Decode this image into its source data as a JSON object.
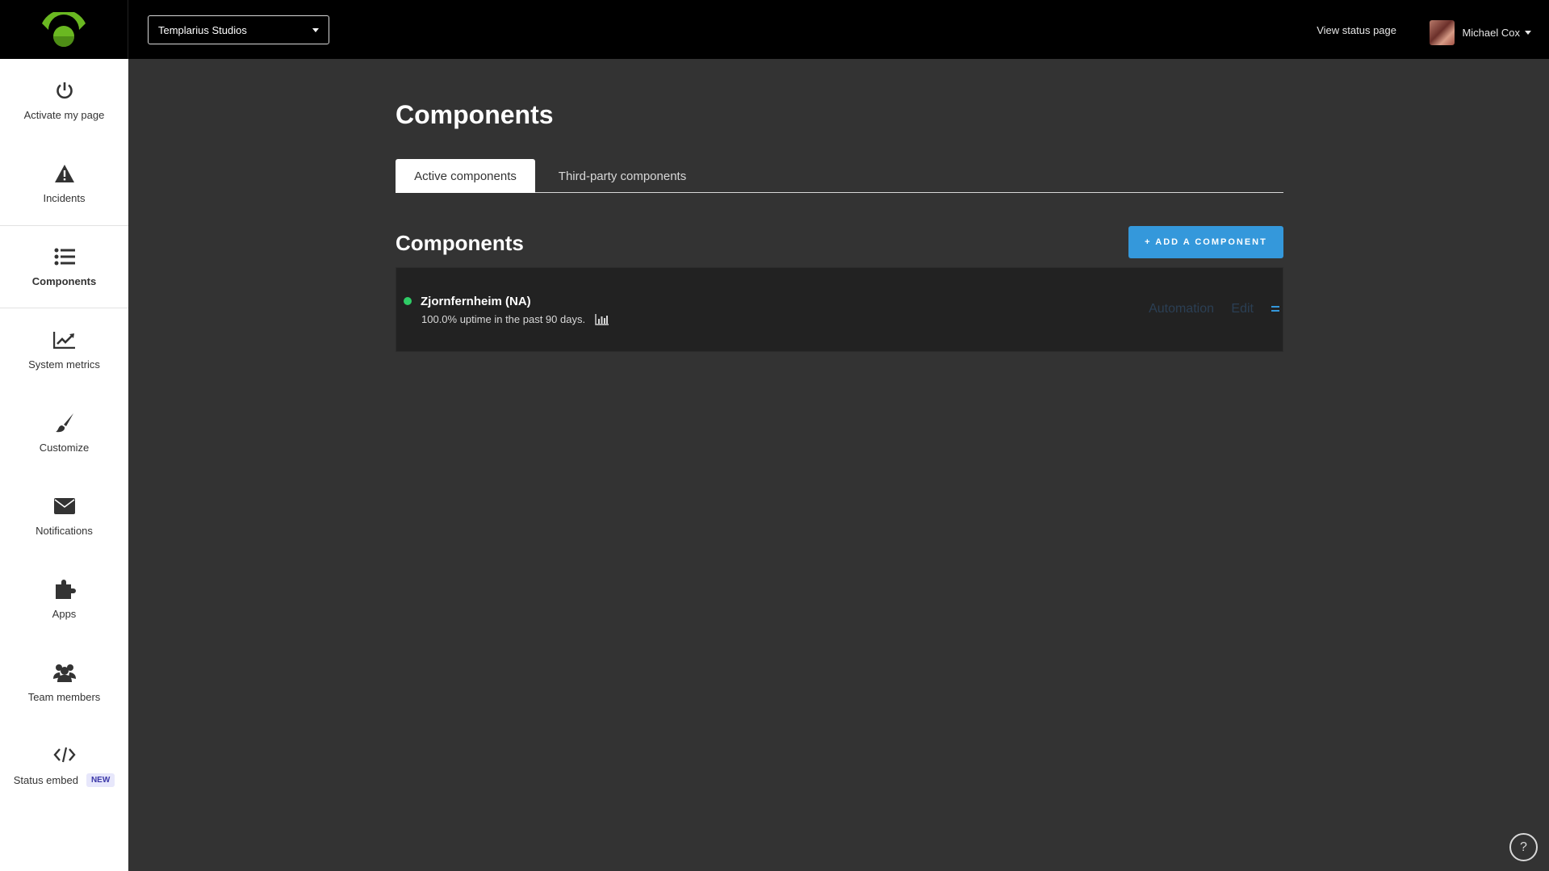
{
  "header": {
    "page_selector": "Templarius Studios",
    "view_status_link": "View status page",
    "user_name": "Michael Cox"
  },
  "sidebar": {
    "items": [
      {
        "label": "Activate my page",
        "icon": "power-icon"
      },
      {
        "label": "Incidents",
        "icon": "warning-icon"
      },
      {
        "label": "Components",
        "icon": "list-icon"
      },
      {
        "label": "System metrics",
        "icon": "line-chart-icon"
      },
      {
        "label": "Customize",
        "icon": "brush-icon"
      },
      {
        "label": "Notifications",
        "icon": "envelope-icon"
      },
      {
        "label": "Apps",
        "icon": "puzzle-icon"
      },
      {
        "label": "Team members",
        "icon": "users-icon"
      },
      {
        "label": "Status embed",
        "icon": "code-icon",
        "badge": "NEW"
      }
    ]
  },
  "main": {
    "title": "Components",
    "tabs": [
      {
        "label": "Active components",
        "active": true
      },
      {
        "label": "Third-party components",
        "active": false
      }
    ],
    "section_title": "Components",
    "add_button": "+ ADD A COMPONENT",
    "components": [
      {
        "name": "Zjornfernheim (NA)",
        "uptime": "100.0% uptime in the past 90 days.",
        "status_color": "#2fcc66",
        "automation_label": "Automation",
        "edit_label": "Edit"
      }
    ]
  },
  "help": "?",
  "colors": {
    "accent": "#3498db",
    "logo_green": "#6ab821",
    "operational": "#2fcc66"
  }
}
